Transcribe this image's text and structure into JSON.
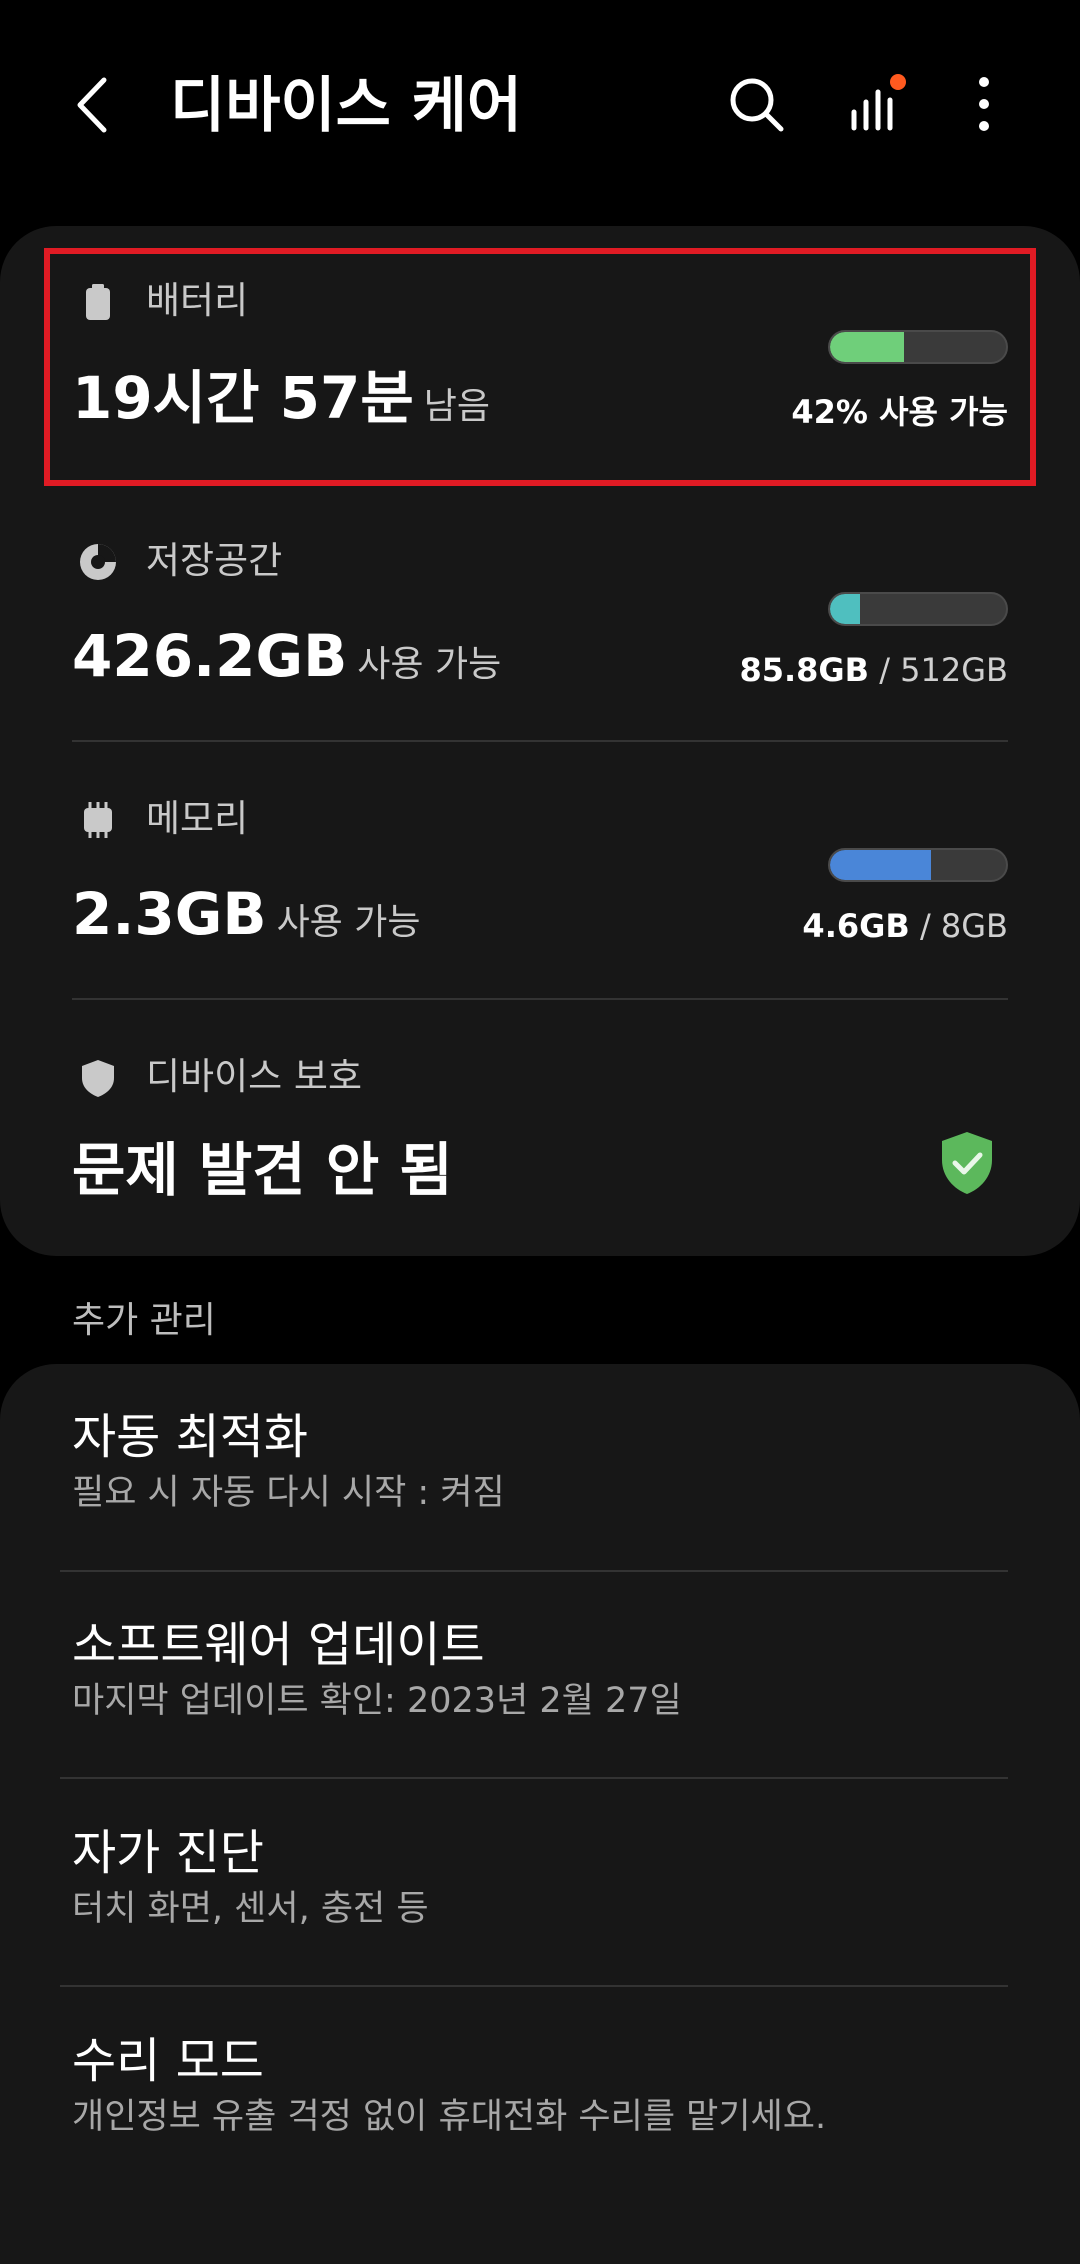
{
  "header": {
    "title": "디바이스 케어",
    "icons": [
      "back-icon",
      "search-icon",
      "stats-icon",
      "more-icon"
    ],
    "notification_dot_color": "#ff5a1f"
  },
  "status": {
    "battery": {
      "label": "배터리",
      "value": "19시간 57분",
      "value_suffix": "남음",
      "right_text": "42% 사용 가능",
      "fill_fraction": 0.42,
      "fill_color": "#6fcf7a"
    },
    "storage": {
      "label": "저장공간",
      "value": "426.2GB",
      "value_suffix": "사용 가능",
      "used": "85.8GB",
      "total": "/ 512GB",
      "fill_fraction": 0.17,
      "fill_color": "#4fbfbf"
    },
    "memory": {
      "label": "메모리",
      "value": "2.3GB",
      "value_suffix": "사용 가능",
      "used": "4.6GB",
      "total": "/ 8GB",
      "fill_fraction": 0.575,
      "fill_color": "#4a86d8"
    },
    "protection": {
      "label": "디바이스 보호",
      "value": "문제 발견 안 됨",
      "shield_color": "#5cb85c"
    }
  },
  "more_section": {
    "header": "추가 관리",
    "items": [
      {
        "title": "자동 최적화",
        "subtitle": "필요 시 자동 다시 시작 : 켜짐"
      },
      {
        "title": "소프트웨어 업데이트",
        "subtitle": "마지막 업데이트 확인: 2023년 2월 27일"
      },
      {
        "title": "자가 진단",
        "subtitle": "터치 화면, 센서, 충전 등"
      },
      {
        "title": "수리 모드",
        "subtitle": "개인정보 유출 걱정 없이 휴대전화 수리를 맡기세요."
      }
    ]
  },
  "colors": {
    "background": "#000000",
    "card": "#171717",
    "highlight_border": "#e01b24"
  }
}
